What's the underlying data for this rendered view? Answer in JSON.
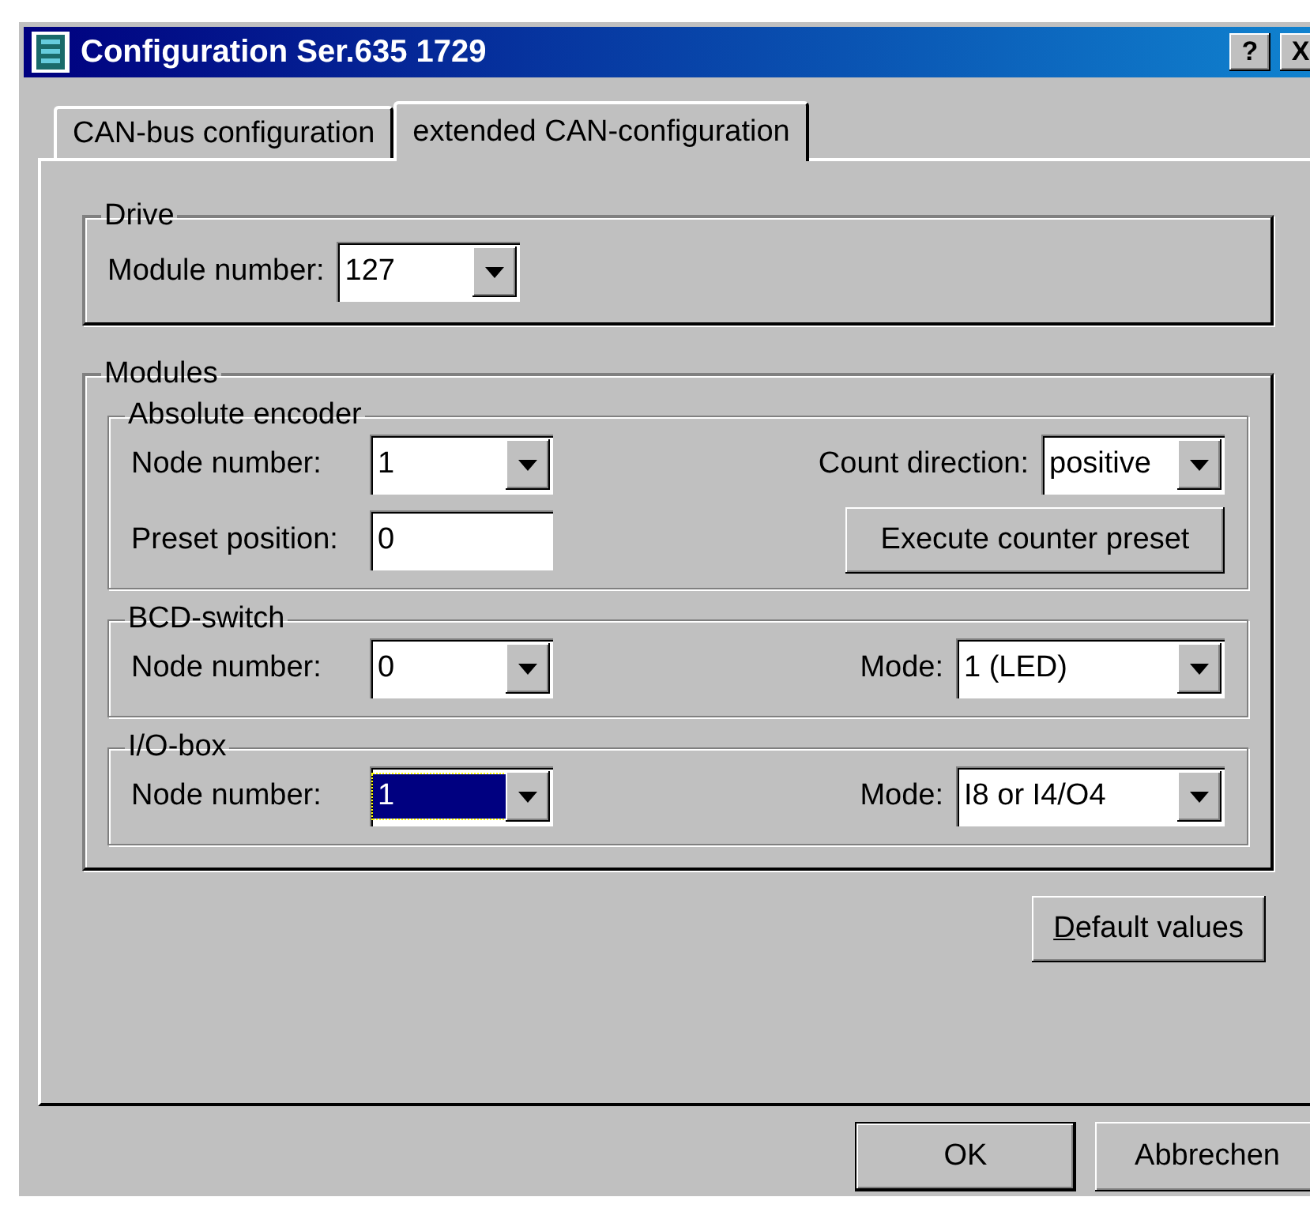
{
  "window": {
    "title": "Configuration Ser.635 1729",
    "title_buttons": [
      "?",
      "X"
    ]
  },
  "tabs": [
    {
      "label": "CAN-bus configuration",
      "selected": false
    },
    {
      "label": "extended CAN-configuration",
      "selected": true
    }
  ],
  "drive": {
    "title": "Drive",
    "rows": [
      {
        "left": {
          "kind": "combo",
          "label": "Module number:",
          "value": "127",
          "focused": false
        }
      }
    ]
  },
  "modules": {
    "title": "Modules",
    "groups": [
      {
        "title": "Absolute encoder",
        "rows": [
          {
            "left": {
              "kind": "combo",
              "label": "Node number:",
              "value": "1",
              "focused": false
            },
            "right": {
              "kind": "combo",
              "label": "Count direction:",
              "value": "positive",
              "focused": false
            }
          },
          {
            "left": {
              "kind": "text",
              "label": "Preset position:",
              "value": "0"
            },
            "right": {
              "kind": "button",
              "label": "Execute counter preset"
            }
          }
        ]
      },
      {
        "title": "BCD-switch",
        "rows": [
          {
            "left": {
              "kind": "combo",
              "label": "Node number:",
              "value": "0",
              "focused": false
            },
            "right": {
              "kind": "combo",
              "label": "Mode:",
              "value": "1 (LED)",
              "focused": false
            }
          }
        ]
      },
      {
        "title": "I/O-box",
        "rows": [
          {
            "left": {
              "kind": "combo",
              "label": "Node number:",
              "value": "1",
              "focused": true
            },
            "right": {
              "kind": "combo",
              "label": "Mode:",
              "value": "I8 or I4/O4",
              "focused": false
            }
          }
        ]
      }
    ]
  },
  "default_button": {
    "label": "Default values",
    "mnemonic_first": true
  },
  "buttons": [
    {
      "label": "OK",
      "default": true
    },
    {
      "label": "Abbrechen",
      "default": false
    }
  ]
}
